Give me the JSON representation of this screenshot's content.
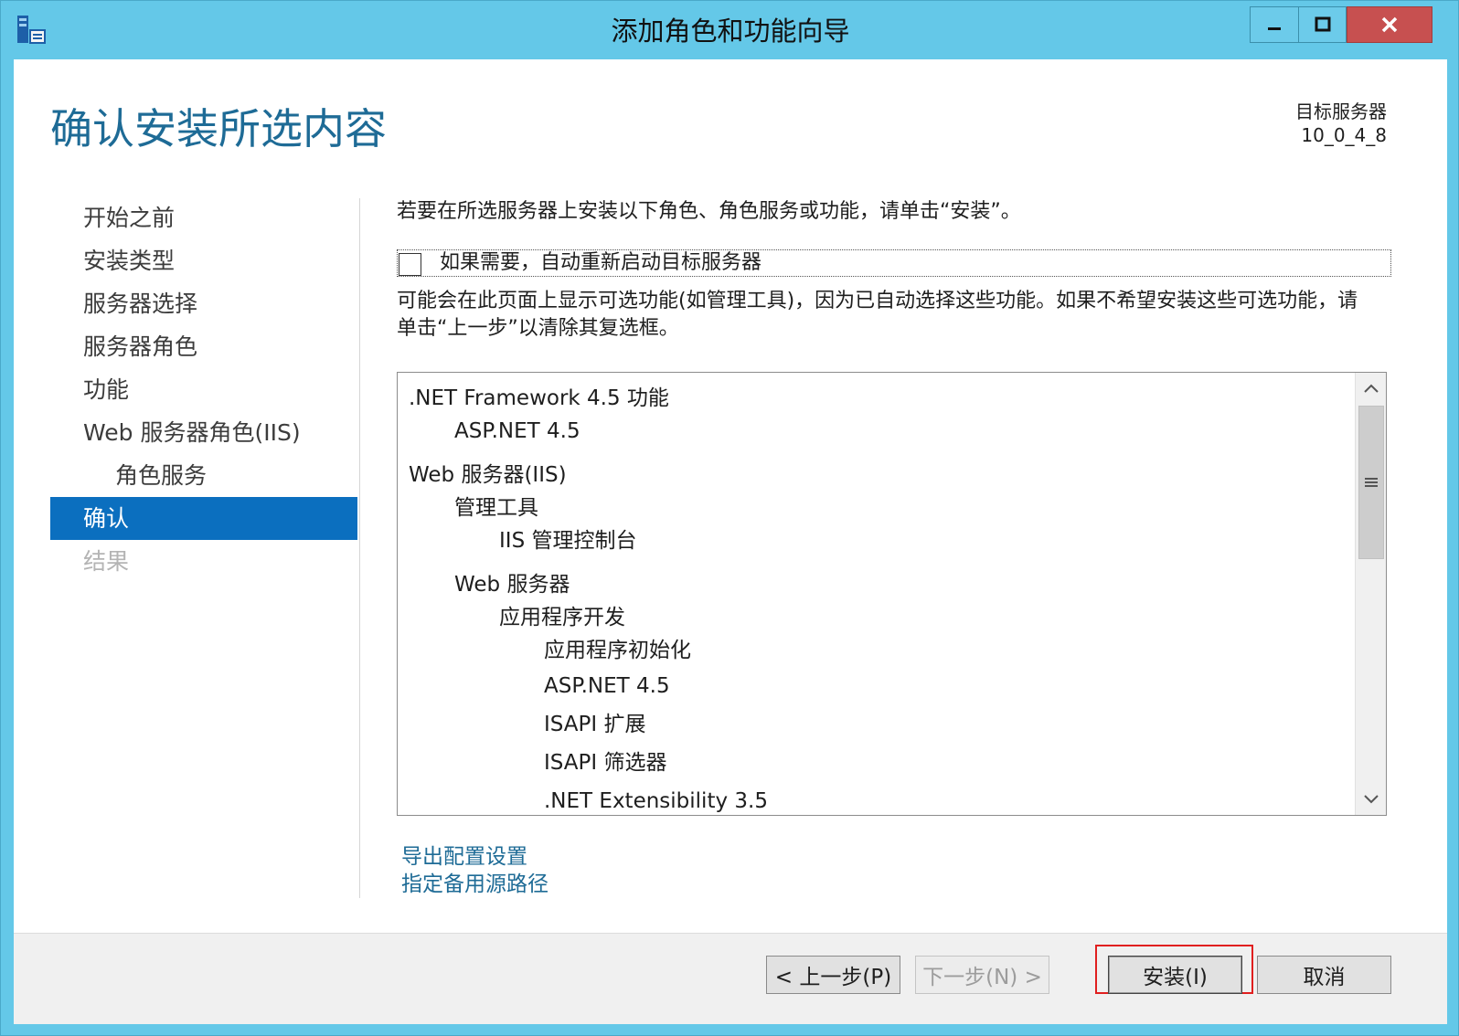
{
  "window": {
    "title": "添加角色和功能向导",
    "icons": {
      "app": "server-manager-icon",
      "minimize": "minimize-icon",
      "maximize": "maximize-icon",
      "close": "close-icon"
    },
    "close_color": "#c75050"
  },
  "header": {
    "page_title": "确认安装所选内容",
    "target_label": "目标服务器",
    "target_value": "10_0_4_8"
  },
  "nav": {
    "items": [
      {
        "label": "开始之前",
        "state": "normal"
      },
      {
        "label": "安装类型",
        "state": "normal"
      },
      {
        "label": "服务器选择",
        "state": "normal"
      },
      {
        "label": "服务器角色",
        "state": "normal"
      },
      {
        "label": "功能",
        "state": "normal"
      },
      {
        "label": "Web 服务器角色(IIS)",
        "state": "normal"
      },
      {
        "label": "角色服务",
        "state": "sub"
      },
      {
        "label": "确认",
        "state": "active"
      },
      {
        "label": "结果",
        "state": "disabled"
      }
    ],
    "active_color": "#0b6fbf"
  },
  "content": {
    "instruction": "若要在所选服务器上安装以下角色、角色服务或功能，请单击“安装”。",
    "restart_label": "如果需要，自动重新启动目标服务器",
    "restart_checked": false,
    "note": "可能会在此页面上显示可选功能(如管理工具)，因为已自动选择这些功能。如果不希望安装这些可选功能，请单击“上一步”以清除其复选框。",
    "features": [
      {
        "label": ".NET Framework 4.5 功能",
        "level": 0
      },
      {
        "label": "ASP.NET 4.5",
        "level": 1
      },
      {
        "label": "Web 服务器(IIS)",
        "level": 0
      },
      {
        "label": "管理工具",
        "level": 1
      },
      {
        "label": "IIS 管理控制台",
        "level": 2
      },
      {
        "label": "Web 服务器",
        "level": 1
      },
      {
        "label": "应用程序开发",
        "level": 2
      },
      {
        "label": "应用程序初始化",
        "level": 3
      },
      {
        "label": "ASP.NET 4.5",
        "level": 3
      },
      {
        "label": "ISAPI 扩展",
        "level": 3
      },
      {
        "label": "ISAPI 筛选器",
        "level": 3
      },
      {
        "label": ".NET Extensibility 3.5",
        "level": 3
      }
    ],
    "links": {
      "export": "导出配置设置",
      "alternate_source": "指定备用源路径"
    },
    "link_color": "#1e6b96"
  },
  "footer": {
    "prev_label": "< 上一步(P)",
    "next_label": "下一步(N) >",
    "install_label": "安装(I)",
    "cancel_label": "取消",
    "highlight_color": "#e01f1f"
  }
}
